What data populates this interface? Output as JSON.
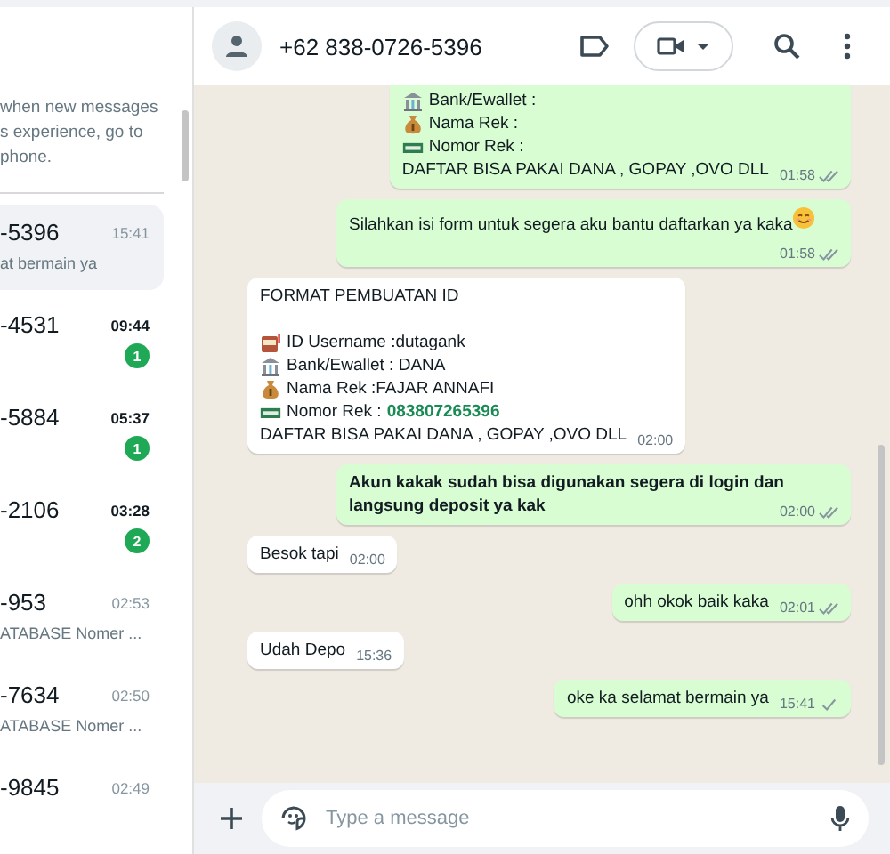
{
  "sidebar": {
    "notice": [
      "when new messages",
      "s experience, go to",
      "phone."
    ],
    "chats": [
      {
        "name": "-5396",
        "time": "15:41",
        "preview": "at bermain ya",
        "selected": true
      },
      {
        "name": "-4531",
        "time": "09:44",
        "unread": "1",
        "selected": false
      },
      {
        "name": "-5884",
        "time": "05:37",
        "unread": "1",
        "selected": false
      },
      {
        "name": "-2106",
        "time": "03:28",
        "unread": "2",
        "selected": false
      },
      {
        "name": "-953",
        "time": "02:53",
        "preview": "ATABASE Nomer ...",
        "selected": false
      },
      {
        "name": "-7634",
        "time": "02:50",
        "preview": "ATABASE Nomer ...",
        "selected": false
      },
      {
        "name": "-9845",
        "time": "02:49",
        "selected": false
      }
    ]
  },
  "header": {
    "contact": "+62 838-0726-5396"
  },
  "messages": [
    {
      "kind": "outgoing",
      "time": "01:58",
      "read": true,
      "bold": false,
      "lines": [
        {
          "kind": "bank",
          "text": "Bank/Ewallet :"
        },
        {
          "kind": "moneybag",
          "text": "Nama Rek      :"
        },
        {
          "kind": "banknote",
          "text": "Nomor Rek   :"
        },
        {
          "kind": "text",
          "text": "DAFTAR BISA PAKAI DANA , GOPAY ,OVO DLL"
        }
      ]
    },
    {
      "kind": "outgoing",
      "time": "01:58",
      "read": true,
      "bold": false,
      "lines": [
        {
          "kind": "smile",
          "text": "Silahkan isi form untuk segera aku bantu daftarkan ya kaka"
        }
      ]
    },
    {
      "kind": "incoming",
      "time": "02:00",
      "bold": false,
      "lines": [
        {
          "kind": "text",
          "text": "FORMAT PEMBUATAN ID"
        },
        {
          "kind": "blank"
        },
        {
          "kind": "slot",
          "text": "ID Username :dutagank"
        },
        {
          "kind": "bank",
          "text": "Bank/Ewallet : DANA"
        },
        {
          "kind": "moneybag",
          "text": "Nama Rek      :FAJAR ANNAFI"
        },
        {
          "kind": "banknote",
          "text": "Nomor Rek   :",
          "link": "083807265396"
        },
        {
          "kind": "text",
          "text": "DAFTAR BISA PAKAI DANA , GOPAY ,OVO DLL"
        }
      ]
    },
    {
      "kind": "outgoing",
      "time": "02:00",
      "read": true,
      "bold": true,
      "lines": [
        {
          "kind": "text",
          "text": "Akun kakak sudah bisa digunakan segera di login dan langsung deposit ya kak"
        }
      ]
    },
    {
      "kind": "incoming",
      "time": "02:00",
      "bold": false,
      "lines": [
        {
          "kind": "text",
          "text": "Besok tapi"
        }
      ]
    },
    {
      "kind": "outgoing",
      "time": "02:01",
      "read": true,
      "bold": false,
      "lines": [
        {
          "kind": "text",
          "text": "ohh okok baik kaka"
        }
      ]
    },
    {
      "kind": "incoming",
      "time": "15:36",
      "bold": false,
      "lines": [
        {
          "kind": "text",
          "text": "Udah Depo"
        }
      ]
    },
    {
      "kind": "outgoing",
      "time": "15:41",
      "read": false,
      "bold": false,
      "lines": [
        {
          "kind": "text",
          "text": "oke ka selamat bermain ya"
        }
      ]
    }
  ],
  "composer": {
    "placeholder": "Type a message"
  }
}
